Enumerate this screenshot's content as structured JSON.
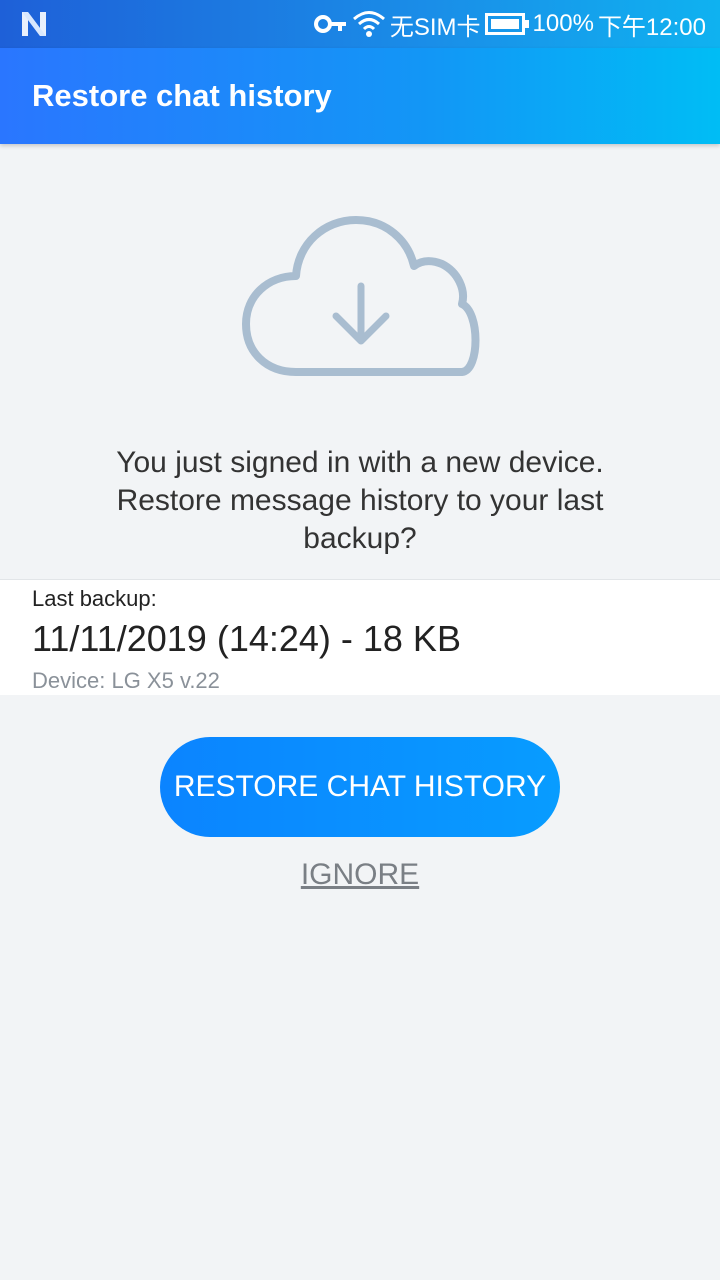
{
  "status_bar": {
    "notification_icon": "n-logo-icon",
    "key_icon": "vpn-key-icon",
    "wifi_icon": "wifi-icon",
    "sim_text": "无SIM卡",
    "battery_icon": "battery-icon",
    "battery_percent": "100%",
    "time": "下午12:00"
  },
  "app_bar": {
    "title": "Restore chat history"
  },
  "hero": {
    "icon": "cloud-download-icon",
    "message": "You just signed in with a new device. Restore message history to your last backup?"
  },
  "backup": {
    "label": "Last backup:",
    "value": "11/11/2019 (14:24) - 18 KB",
    "device": "Device: LG X5 v.22"
  },
  "actions": {
    "restore_label": "RESTORE CHAT HISTORY",
    "ignore_label": "IGNORE"
  },
  "colors": {
    "accent": "#0b84ff",
    "cloud": "#a9bdd0",
    "background": "#f2f4f6"
  }
}
